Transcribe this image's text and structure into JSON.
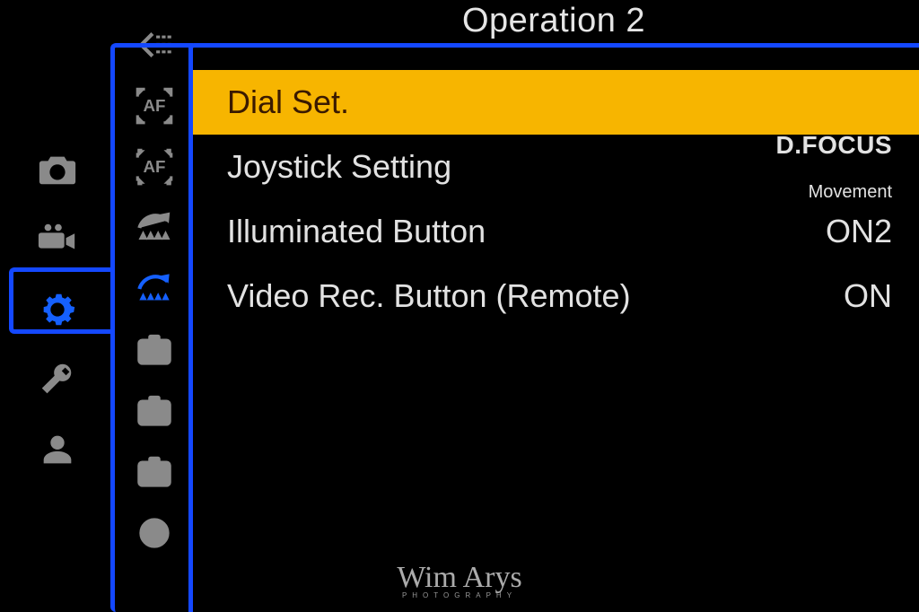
{
  "header": {
    "title": "Operation 2"
  },
  "primaryTabs": {
    "items": [
      {
        "name": "photo-tab",
        "icon": "camera"
      },
      {
        "name": "video-tab",
        "icon": "video"
      },
      {
        "name": "custom-tab",
        "icon": "gear",
        "active": true
      },
      {
        "name": "setup-tab",
        "icon": "wrench"
      },
      {
        "name": "mymenu-tab",
        "icon": "person"
      }
    ]
  },
  "subTabs": {
    "items": [
      {
        "name": "subtab-return",
        "icon": "return-arrow"
      },
      {
        "name": "subtab-af-solid",
        "icon": "af-solid"
      },
      {
        "name": "subtab-af-dashed",
        "icon": "af-dashed"
      },
      {
        "name": "subtab-dial-reset1",
        "icon": "dial-arc"
      },
      {
        "name": "subtab-dial-reset2",
        "icon": "dial-arc-fill"
      },
      {
        "name": "subtab-monitor1",
        "icon": "card1"
      },
      {
        "name": "subtab-monitor2",
        "icon": "card2"
      },
      {
        "name": "subtab-monitor3",
        "icon": "card3"
      },
      {
        "name": "subtab-lens",
        "icon": "lens"
      }
    ]
  },
  "menu": {
    "rows": [
      {
        "label": "Dial Set.",
        "value": "",
        "selected": true
      },
      {
        "label": "Joystick Setting",
        "value_l1": "D.FOCUS",
        "value_l2": "Movement",
        "selected": false,
        "focusStyle": true
      },
      {
        "label": "Illuminated Button",
        "value": "ON2",
        "selected": false
      },
      {
        "label": "Video Rec. Button (Remote)",
        "value": "ON",
        "selected": false
      }
    ]
  },
  "watermark": {
    "name": "Wim Arys",
    "sub": "PHOTOGRAPHY"
  }
}
